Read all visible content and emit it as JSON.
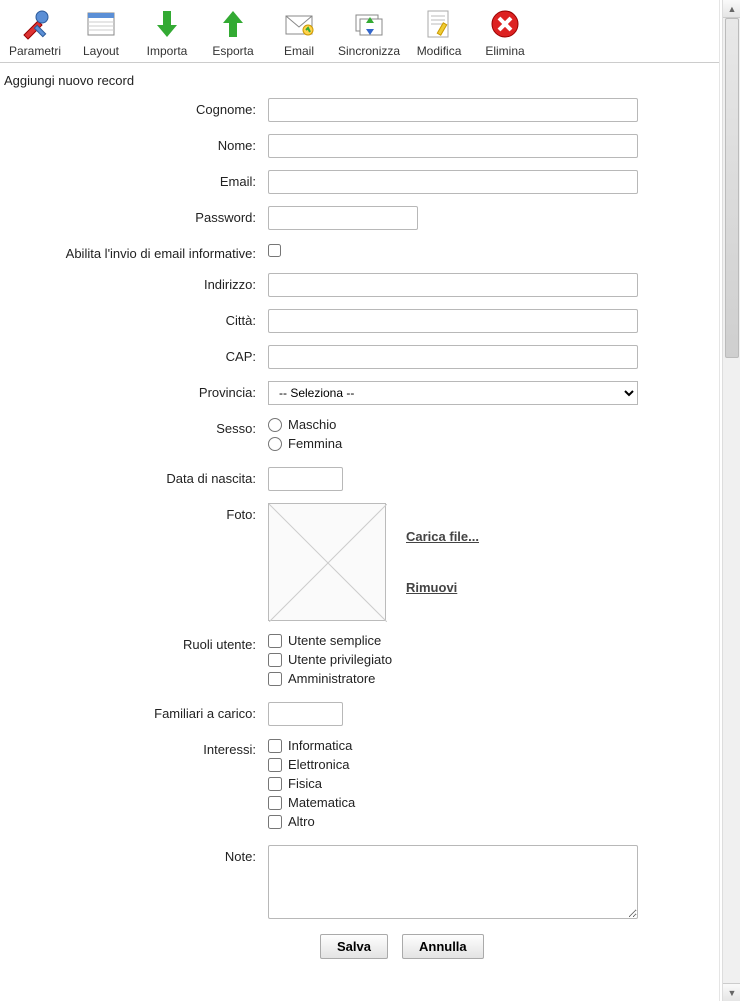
{
  "toolbar": {
    "items": [
      {
        "label": "Parametri",
        "name": "toolbar-parametri"
      },
      {
        "label": "Layout",
        "name": "toolbar-layout"
      },
      {
        "label": "Importa",
        "name": "toolbar-importa"
      },
      {
        "label": "Esporta",
        "name": "toolbar-esporta"
      },
      {
        "label": "Email",
        "name": "toolbar-email"
      },
      {
        "label": "Sincronizza",
        "name": "toolbar-sincronizza"
      },
      {
        "label": "Modifica",
        "name": "toolbar-modifica"
      },
      {
        "label": "Elimina",
        "name": "toolbar-elimina"
      }
    ]
  },
  "page_title": "Aggiungi nuovo record",
  "form": {
    "cognome": {
      "label": "Cognome:",
      "value": ""
    },
    "nome": {
      "label": "Nome:",
      "value": ""
    },
    "email": {
      "label": "Email:",
      "value": ""
    },
    "password": {
      "label": "Password:",
      "value": ""
    },
    "email_info": {
      "label": "Abilita l'invio di email informative:",
      "checked": false
    },
    "indirizzo": {
      "label": "Indirizzo:",
      "value": ""
    },
    "citta": {
      "label": "Città:",
      "value": ""
    },
    "cap": {
      "label": "CAP:",
      "value": ""
    },
    "provincia": {
      "label": "Provincia:",
      "selected": "-- Seleziona --"
    },
    "sesso": {
      "label": "Sesso:",
      "options": [
        "Maschio",
        "Femmina"
      ],
      "selected": null
    },
    "data_nascita": {
      "label": "Data di nascita:",
      "value": ""
    },
    "foto": {
      "label": "Foto:",
      "upload_link": "Carica file...",
      "remove_link": "Rimuovi"
    },
    "ruoli": {
      "label": "Ruoli utente:",
      "options": [
        "Utente semplice",
        "Utente privilegiato",
        "Amministratore"
      ]
    },
    "familiari": {
      "label": "Familiari a carico:",
      "value": ""
    },
    "interessi": {
      "label": "Interessi:",
      "options": [
        "Informatica",
        "Elettronica",
        "Fisica",
        "Matematica",
        "Altro"
      ]
    },
    "note": {
      "label": "Note:",
      "value": ""
    }
  },
  "buttons": {
    "save": "Salva",
    "cancel": "Annulla"
  }
}
